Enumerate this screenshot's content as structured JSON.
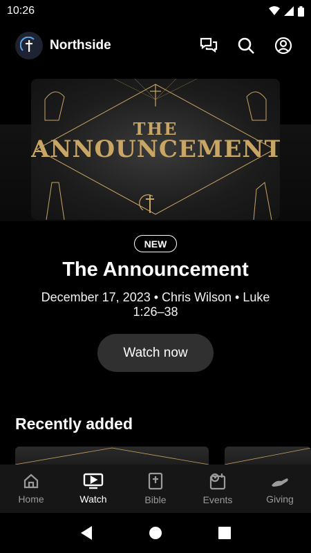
{
  "status": {
    "time": "10:26"
  },
  "header": {
    "church_name": "Northside"
  },
  "hero": {
    "art_line1": "THE",
    "art_line2": "ANNOUNCEMENT",
    "badge": "NEW",
    "title": "The Announcement",
    "meta": "December 17, 2023 • Chris Wilson • Luke 1:26–38",
    "watch_label": "Watch now"
  },
  "recent": {
    "title": "Recently added"
  },
  "nav": {
    "items": [
      {
        "label": "Home",
        "icon": "home-icon"
      },
      {
        "label": "Watch",
        "icon": "tv-icon"
      },
      {
        "label": "Bible",
        "icon": "bible-icon"
      },
      {
        "label": "Events",
        "icon": "calendar-icon"
      },
      {
        "label": "Giving",
        "icon": "giving-icon"
      }
    ],
    "active": "Watch"
  },
  "colors": {
    "accent_gold": "#c9a664",
    "bg": "#000000",
    "nav_bg": "#161616",
    "button_bg": "#303030"
  }
}
